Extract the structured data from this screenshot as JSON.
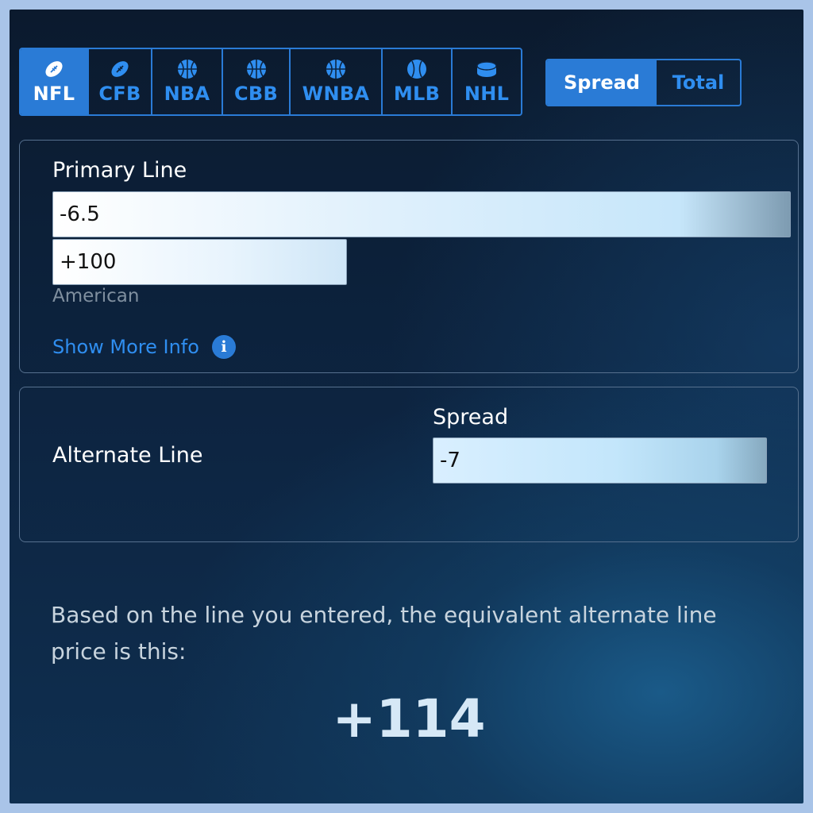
{
  "sports": [
    {
      "label": "NFL",
      "icon": "football-icon",
      "active": true
    },
    {
      "label": "CFB",
      "icon": "football-icon",
      "active": false
    },
    {
      "label": "NBA",
      "icon": "basketball-icon",
      "active": false
    },
    {
      "label": "CBB",
      "icon": "basketball-icon",
      "active": false
    },
    {
      "label": "WNBA",
      "icon": "basketball-icon",
      "active": false
    },
    {
      "label": "MLB",
      "icon": "baseball-icon",
      "active": false
    },
    {
      "label": "NHL",
      "icon": "hockey-puck-icon",
      "active": false
    }
  ],
  "modes": [
    {
      "label": "Spread",
      "active": true
    },
    {
      "label": "Total",
      "active": false
    }
  ],
  "primary": {
    "title": "Primary Line",
    "line_value": "-6.5",
    "odds_value": "+100",
    "odds_format": "American",
    "more_info": "Show More Info"
  },
  "alternate": {
    "title": "Alternate Line",
    "field_label": "Spread",
    "value": "-7"
  },
  "result": {
    "text": "Based on the line you entered, the equivalent alternate line price is this:",
    "value": "+114"
  },
  "colors": {
    "accent": "#2a7bd6",
    "accent_text": "#2f8ef0",
    "background": "#0d2542"
  }
}
